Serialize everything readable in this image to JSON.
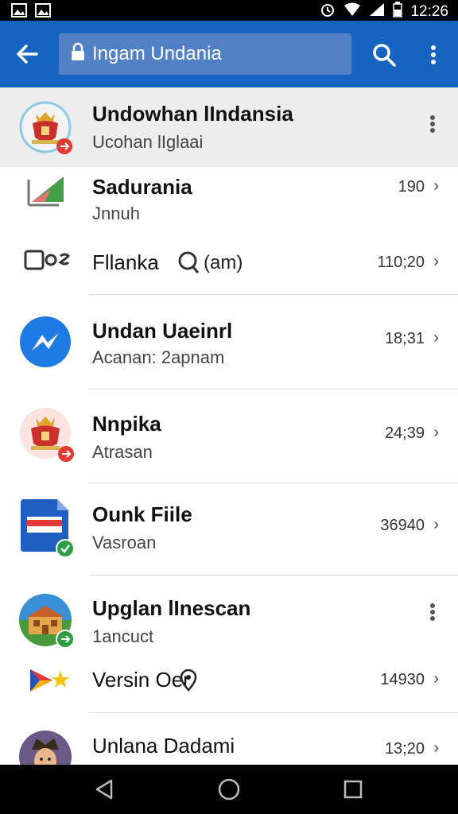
{
  "status_bar": {
    "time": "12:26"
  },
  "toolbar": {
    "url": "Ingam Undania"
  },
  "list": [
    {
      "title": "Undowhan lIndansia",
      "subtitle": "Ucohan lIglaai"
    },
    {
      "title": "Sadurania",
      "subtitle": "Jnnuh",
      "time": "190"
    },
    {
      "title": "Fllanka",
      "subtitle": "(am)",
      "time": "110;20"
    },
    {
      "title": "Undan Uaeinrl",
      "subtitle": "Acanan: 2apnam",
      "time": "18;31"
    },
    {
      "title": "Nnpika",
      "subtitle": "Atrasan",
      "time": "24;39"
    },
    {
      "title": "Ounk Fiile",
      "subtitle": "Vasroan",
      "time": "36940"
    },
    {
      "title": "Upglan lInescan",
      "subtitle": "1ancuct"
    },
    {
      "title": "Versin Oer",
      "time": "14930"
    },
    {
      "title": "Unlana Dadami",
      "time": "13;20"
    }
  ],
  "colors": {
    "toolbar": "#1565c0",
    "url_field": "#5180c4",
    "messenger": "#1e7be3",
    "highlight_row": "#ededed"
  }
}
